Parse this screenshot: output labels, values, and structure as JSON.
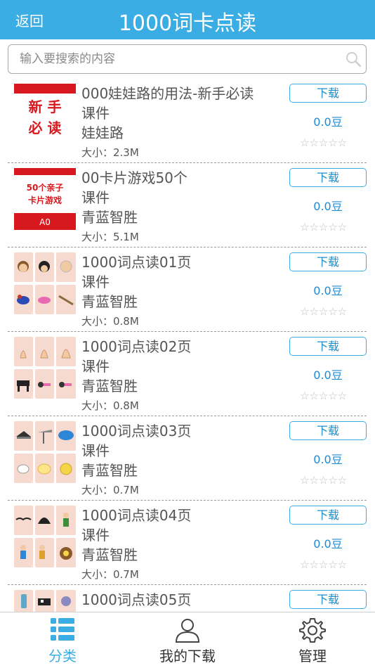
{
  "header": {
    "back_label": "返回",
    "title": "1000词卡点读"
  },
  "search": {
    "placeholder": "输入要搜索的内容"
  },
  "items": [
    {
      "name": "000娃娃路的用法-新手必读",
      "type": "课件",
      "author": "娃娃路",
      "size": "大小：2.3M",
      "price": "0.0豆",
      "download_label": "下载",
      "stars": "☆☆☆☆☆",
      "thumb_text": [
        "新 手",
        "必 读"
      ]
    },
    {
      "name": "00卡片游戏50个",
      "type": "课件",
      "author": "青蓝智胜",
      "size": "大小：5.1M",
      "price": "0.0豆",
      "download_label": "下载",
      "stars": "☆☆☆☆☆",
      "thumb_text": [
        "50个亲子",
        "卡片游戏",
        "A0"
      ]
    },
    {
      "name": "1000词点读01页",
      "type": "课件",
      "author": "青蓝智胜",
      "size": "大小：0.8M",
      "price": "0.0豆",
      "download_label": "下载",
      "stars": "☆☆☆☆☆"
    },
    {
      "name": "1000词点读02页",
      "type": "课件",
      "author": "青蓝智胜",
      "size": "大小：0.8M",
      "price": "0.0豆",
      "download_label": "下载",
      "stars": "☆☆☆☆☆"
    },
    {
      "name": "1000词点读03页",
      "type": "课件",
      "author": "青蓝智胜",
      "size": "大小：0.7M",
      "price": "0.0豆",
      "download_label": "下载",
      "stars": "☆☆☆☆☆"
    },
    {
      "name": "1000词点读04页",
      "type": "课件",
      "author": "青蓝智胜",
      "size": "大小：0.7M",
      "price": "0.0豆",
      "download_label": "下载",
      "stars": "☆☆☆☆☆"
    },
    {
      "name": "1000词点读05页",
      "type": "",
      "author": "",
      "size": "",
      "price": "",
      "download_label": "下载",
      "stars": ""
    }
  ],
  "tabs": [
    {
      "label": "分类",
      "icon": "category-grid-icon",
      "active": true
    },
    {
      "label": "我的下载",
      "icon": "person-icon",
      "active": false
    },
    {
      "label": "管理",
      "icon": "gear-icon",
      "active": false
    }
  ],
  "colors": {
    "accent": "#3aaee4",
    "price": "#1a8ad6",
    "thumb_red": "#d7191f",
    "thumb_tile": "#f6d9cf"
  }
}
